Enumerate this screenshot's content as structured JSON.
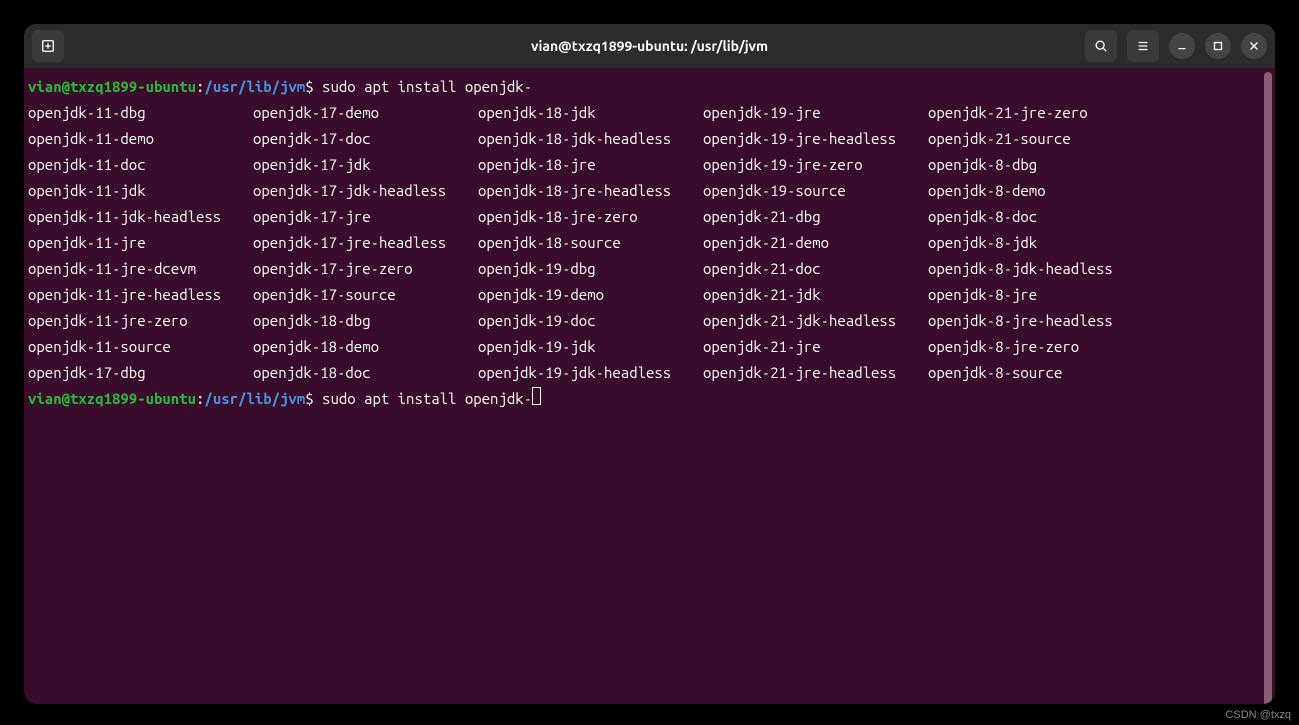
{
  "titlebar": {
    "title": "vian@txzq1899-ubuntu: /usr/lib/jvm"
  },
  "prompt": {
    "user_host": "vian@txzq1899-ubuntu",
    "colon": ":",
    "path": "/usr/lib/jvm",
    "dollar": "$",
    "command": "sudo apt install openjdk-"
  },
  "completions": {
    "col1": [
      "openjdk-11-dbg",
      "openjdk-11-demo",
      "openjdk-11-doc",
      "openjdk-11-jdk",
      "openjdk-11-jdk-headless",
      "openjdk-11-jre",
      "openjdk-11-jre-dcevm",
      "openjdk-11-jre-headless",
      "openjdk-11-jre-zero",
      "openjdk-11-source",
      "openjdk-17-dbg"
    ],
    "col2": [
      "openjdk-17-demo",
      "openjdk-17-doc",
      "openjdk-17-jdk",
      "openjdk-17-jdk-headless",
      "openjdk-17-jre",
      "openjdk-17-jre-headless",
      "openjdk-17-jre-zero",
      "openjdk-17-source",
      "openjdk-18-dbg",
      "openjdk-18-demo",
      "openjdk-18-doc"
    ],
    "col3": [
      "openjdk-18-jdk",
      "openjdk-18-jdk-headless",
      "openjdk-18-jre",
      "openjdk-18-jre-headless",
      "openjdk-18-jre-zero",
      "openjdk-18-source",
      "openjdk-19-dbg",
      "openjdk-19-demo",
      "openjdk-19-doc",
      "openjdk-19-jdk",
      "openjdk-19-jdk-headless"
    ],
    "col4": [
      "openjdk-19-jre",
      "openjdk-19-jre-headless",
      "openjdk-19-jre-zero",
      "openjdk-19-source",
      "openjdk-21-dbg",
      "openjdk-21-demo",
      "openjdk-21-doc",
      "openjdk-21-jdk",
      "openjdk-21-jdk-headless",
      "openjdk-21-jre",
      "openjdk-21-jre-headless"
    ],
    "col5": [
      "openjdk-21-jre-zero",
      "openjdk-21-source",
      "openjdk-8-dbg",
      "openjdk-8-demo",
      "openjdk-8-doc",
      "openjdk-8-jdk",
      "openjdk-8-jdk-headless",
      "openjdk-8-jre",
      "openjdk-8-jre-headless",
      "openjdk-8-jre-zero",
      "openjdk-8-source"
    ]
  },
  "watermark": "CSDN @txzq"
}
